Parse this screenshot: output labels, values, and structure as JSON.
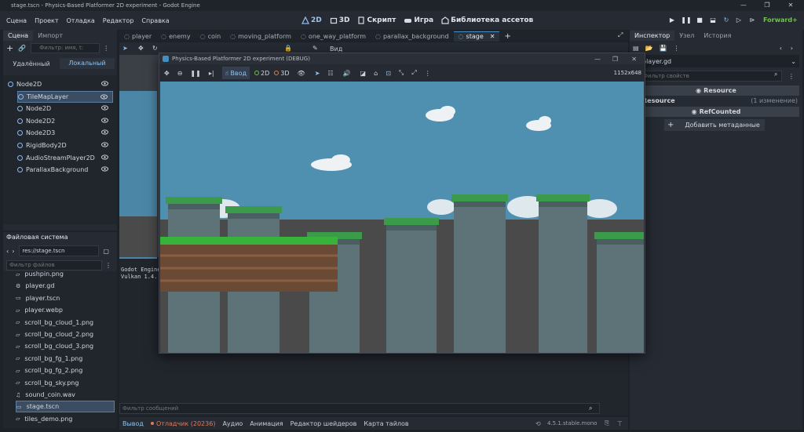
{
  "titlebar": {
    "title": "stage.tscn - Physics-Based Platformer 2D experiment - Godot Engine"
  },
  "menu": [
    "Сцена",
    "Проект",
    "Отладка",
    "Редактор",
    "Справка"
  ],
  "workspaces": {
    "two_d": "2D",
    "three_d": "3D",
    "script": "Скрипт",
    "game": "Игра",
    "assetlib": "Библиотека ассетов"
  },
  "renderer": "Forward+",
  "scene_dock": {
    "tabs": [
      "Сцена",
      "Импорт"
    ],
    "filter_placeholder": "Фильтр: имя, t:",
    "remote": "Удалённый",
    "local": "Локальный",
    "nodes": [
      {
        "name": "Node2D",
        "icon": "node2d-icon"
      },
      {
        "name": "TileMapLayer",
        "icon": "tilemap-icon"
      },
      {
        "name": "Node2D",
        "icon": "node2d-icon"
      },
      {
        "name": "Node2D2",
        "icon": "node2d-icon"
      },
      {
        "name": "Node2D3",
        "icon": "node2d-icon"
      },
      {
        "name": "RigidBody2D",
        "icon": "rigidbody-icon"
      },
      {
        "name": "AudioStreamPlayer2D",
        "icon": "audio-icon"
      },
      {
        "name": "ParallaxBackground",
        "icon": "parallax-icon"
      }
    ]
  },
  "filesystem": {
    "title": "Файловая система",
    "path": "res://stage.tscn",
    "filter_placeholder": "Фильтр файлов",
    "files": [
      "pushpin.png",
      "player.gd",
      "player.tscn",
      "player.webp",
      "scroll_bg_cloud_1.png",
      "scroll_bg_cloud_2.png",
      "scroll_bg_cloud_3.png",
      "scroll_bg_fg_1.png",
      "scroll_bg_fg_2.png",
      "scroll_bg_sky.png",
      "sound_coin.wav",
      "stage.tscn",
      "tiles_demo.png"
    ],
    "selected": "stage.tscn"
  },
  "scene_tabs": [
    "player",
    "enemy",
    "coin",
    "moving_platform",
    "one_way_platform",
    "parallax_background",
    "stage"
  ],
  "editor_toolbar": {
    "view": "Вид"
  },
  "output": {
    "lines": [
      "Godot Engine",
      "Vulkan 1.4."
    ],
    "filter_placeholder": "Фильтр сообщений"
  },
  "bottom_tabs": {
    "output": "Вывод",
    "debugger": "Отладчик (20236)",
    "audio": "Аудио",
    "animation": "Анимация",
    "shader": "Редактор шейдеров",
    "tilemap": "Карта тайлов"
  },
  "version": "4.5.1.stable.mono",
  "inspector": {
    "tabs": [
      "Инспектор",
      "Узел",
      "История"
    ],
    "file": "player.gd",
    "filter_placeholder": "Фильтр свойств",
    "resource_section": "Resource",
    "resource_label": "Resource",
    "changes": "(1 изменение)",
    "refcounted": "RefCounted",
    "add_meta": "Добавить метаданные"
  },
  "game_window": {
    "title": "Physics-Based Platformer 2D experiment (DEBUG)",
    "input": "Ввод",
    "two_d": "2D",
    "three_d": "3D",
    "resolution": "1152x648"
  },
  "colors": {
    "accent": "#478cbf",
    "sky": "#4f90b0",
    "grass": "#37b23a",
    "ground": "#4a4a4a",
    "debug": "#e07b5b",
    "renderer": "#6cc644"
  }
}
